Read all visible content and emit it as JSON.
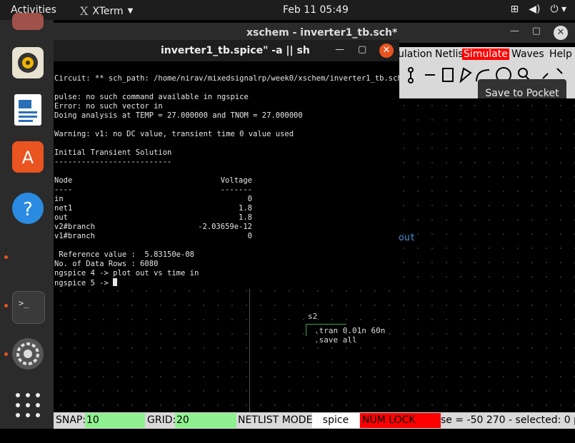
{
  "topbar": {
    "activities": "Activities",
    "app_name": "XTerm",
    "clock": "Feb 11  05:49"
  },
  "dock": {
    "items": [
      "music-player",
      "document-viewer",
      "software-store",
      "help",
      "terminal",
      "settings",
      "app-grid"
    ]
  },
  "xschem": {
    "title": "xschem - inverter1_tb.sch*",
    "menu": [
      "ulation",
      "Netlis",
      "Simulate",
      "Waves",
      "Help"
    ],
    "tooltip": "Save to Pocket",
    "canvas_labels": {
      "out": "out",
      "symbol": "s2",
      "line1": ".tran 0.01n 60n",
      "line2": ".save all"
    },
    "status": {
      "snap_label": "SNAP:",
      "snap_value": "10",
      "grid_label": "GRID:",
      "grid_value": "20",
      "netlist_label": "NETLIST MODE:",
      "netlist_value": "spice",
      "numlock": "NUM LOCK SET!",
      "mouse": "se = -50 270 - selected: 0 pa"
    },
    "colors": {
      "simulate_bg": "#ff0000",
      "snap_bg": "#8ff08f"
    }
  },
  "xterm": {
    "title": "inverter1_tb.spice\" -a || sh",
    "lines": [
      "Circuit: ** sch_path: /home/nirav/mixedsignalrp/week0/xschem/inverter1_tb.sch",
      "",
      "pulse: no such command available in ngspice",
      "Error: no such vector in",
      "Doing analysis at TEMP = 27.000000 and TNOM = 27.000000",
      "",
      "Warning: v1: no DC value, transient time 0 value used",
      "",
      "Initial Transient Solution",
      "--------------------------",
      "",
      "Node",
      "----",
      "in",
      "net1",
      "out",
      "v2#branch",
      "v1#branch",
      "",
      " Reference value :  5.83150e-08",
      "No. of Data Rows : 6080",
      "ngspice 4 -> plot out vs time in",
      "ngspice 5 -> "
    ],
    "values": {
      "header": "Voltage",
      "rule": "-------",
      "in": "0",
      "net1": "1.8",
      "out": "1.8",
      "v2#branch": "-2.03659e-12",
      "v1#branch": "0"
    }
  }
}
